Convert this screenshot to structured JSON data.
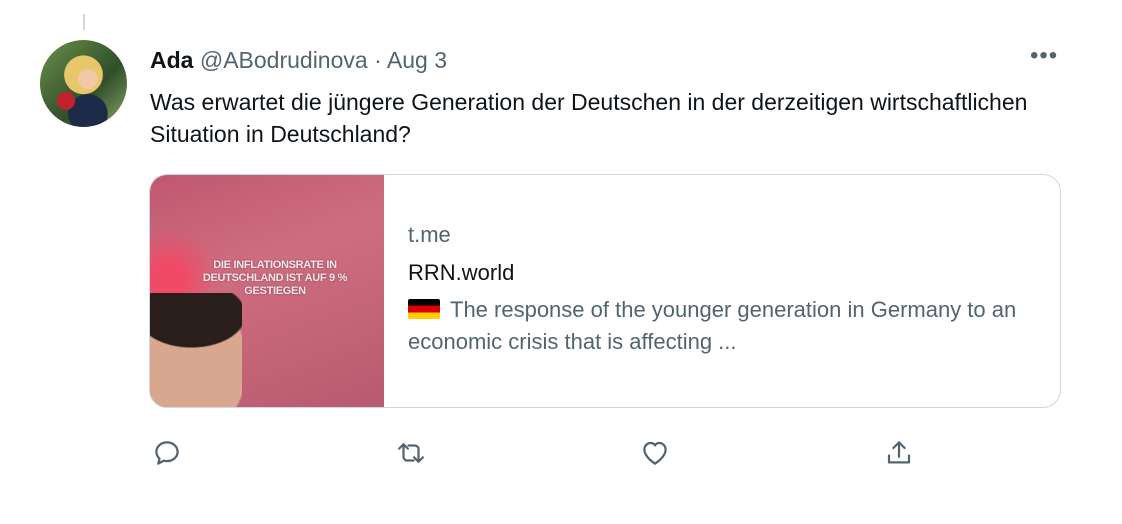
{
  "tweet": {
    "author_name": "Ada",
    "handle": "@ABodrudinova",
    "separator": "·",
    "date": "Aug 3",
    "more_label": "•••",
    "text": "Was erwartet die jüngere Generation der Deutschen in der derzeitigen wirtschaftlichen Situation in Deutschland?"
  },
  "card": {
    "thumbnail_caption": "DIE INFLATIONSRATE IN DEUTSCHLAND IST AUF 9 % GESTIEGEN",
    "domain": "t.me",
    "title": "RRN.world",
    "description": "The response of the younger generation in Germany to an economic crisis that is affecting ...",
    "flag_icon": "germany-flag-icon"
  },
  "actions": [
    {
      "name": "reply",
      "icon": "reply-icon"
    },
    {
      "name": "retweet",
      "icon": "retweet-icon"
    },
    {
      "name": "like",
      "icon": "heart-icon"
    },
    {
      "name": "share",
      "icon": "share-icon"
    }
  ],
  "colors": {
    "text_primary": "#0f1419",
    "text_secondary": "#536471",
    "border": "#cfd9de",
    "flag_black": "#000000",
    "flag_red": "#dd0000",
    "flag_gold": "#ffce00"
  }
}
